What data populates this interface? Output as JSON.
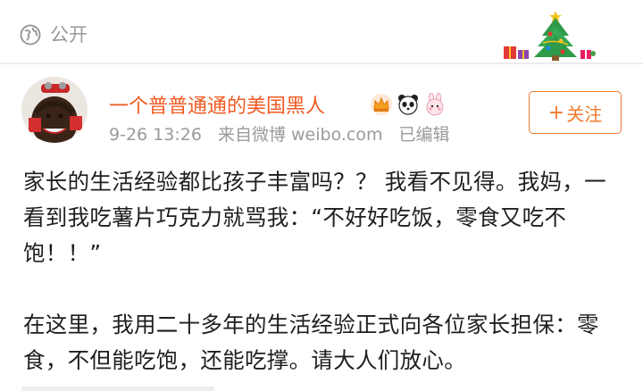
{
  "visibility": {
    "icon": "globe-icon",
    "label": "公开"
  },
  "decoration": {
    "icon": "christmas-tree-icon"
  },
  "post": {
    "author": {
      "name": "一个普普通通的美国黑人",
      "badges": [
        "crown-icon",
        "panda-icon",
        "rabbit-icon"
      ]
    },
    "time": "9-26 13:26",
    "source": "来自微博 weibo.com",
    "edited": "已编辑",
    "follow_label": "关注",
    "paragraphs": [
      "家长的生活经验都比孩子丰富吗？？ 我看不见得。我妈，一看到我吃薯片巧克力就骂我：“不好好吃饭，零食又吃不饱！！”",
      "在这里，我用二十多年的生活经验正式向各位家长担保：零食，不但能吃饱，还能吃撑。请大人们放心。"
    ]
  },
  "colors": {
    "accent": "#f05a22",
    "follow": "#f07a2e",
    "meta_text": "#9a9a9a"
  }
}
